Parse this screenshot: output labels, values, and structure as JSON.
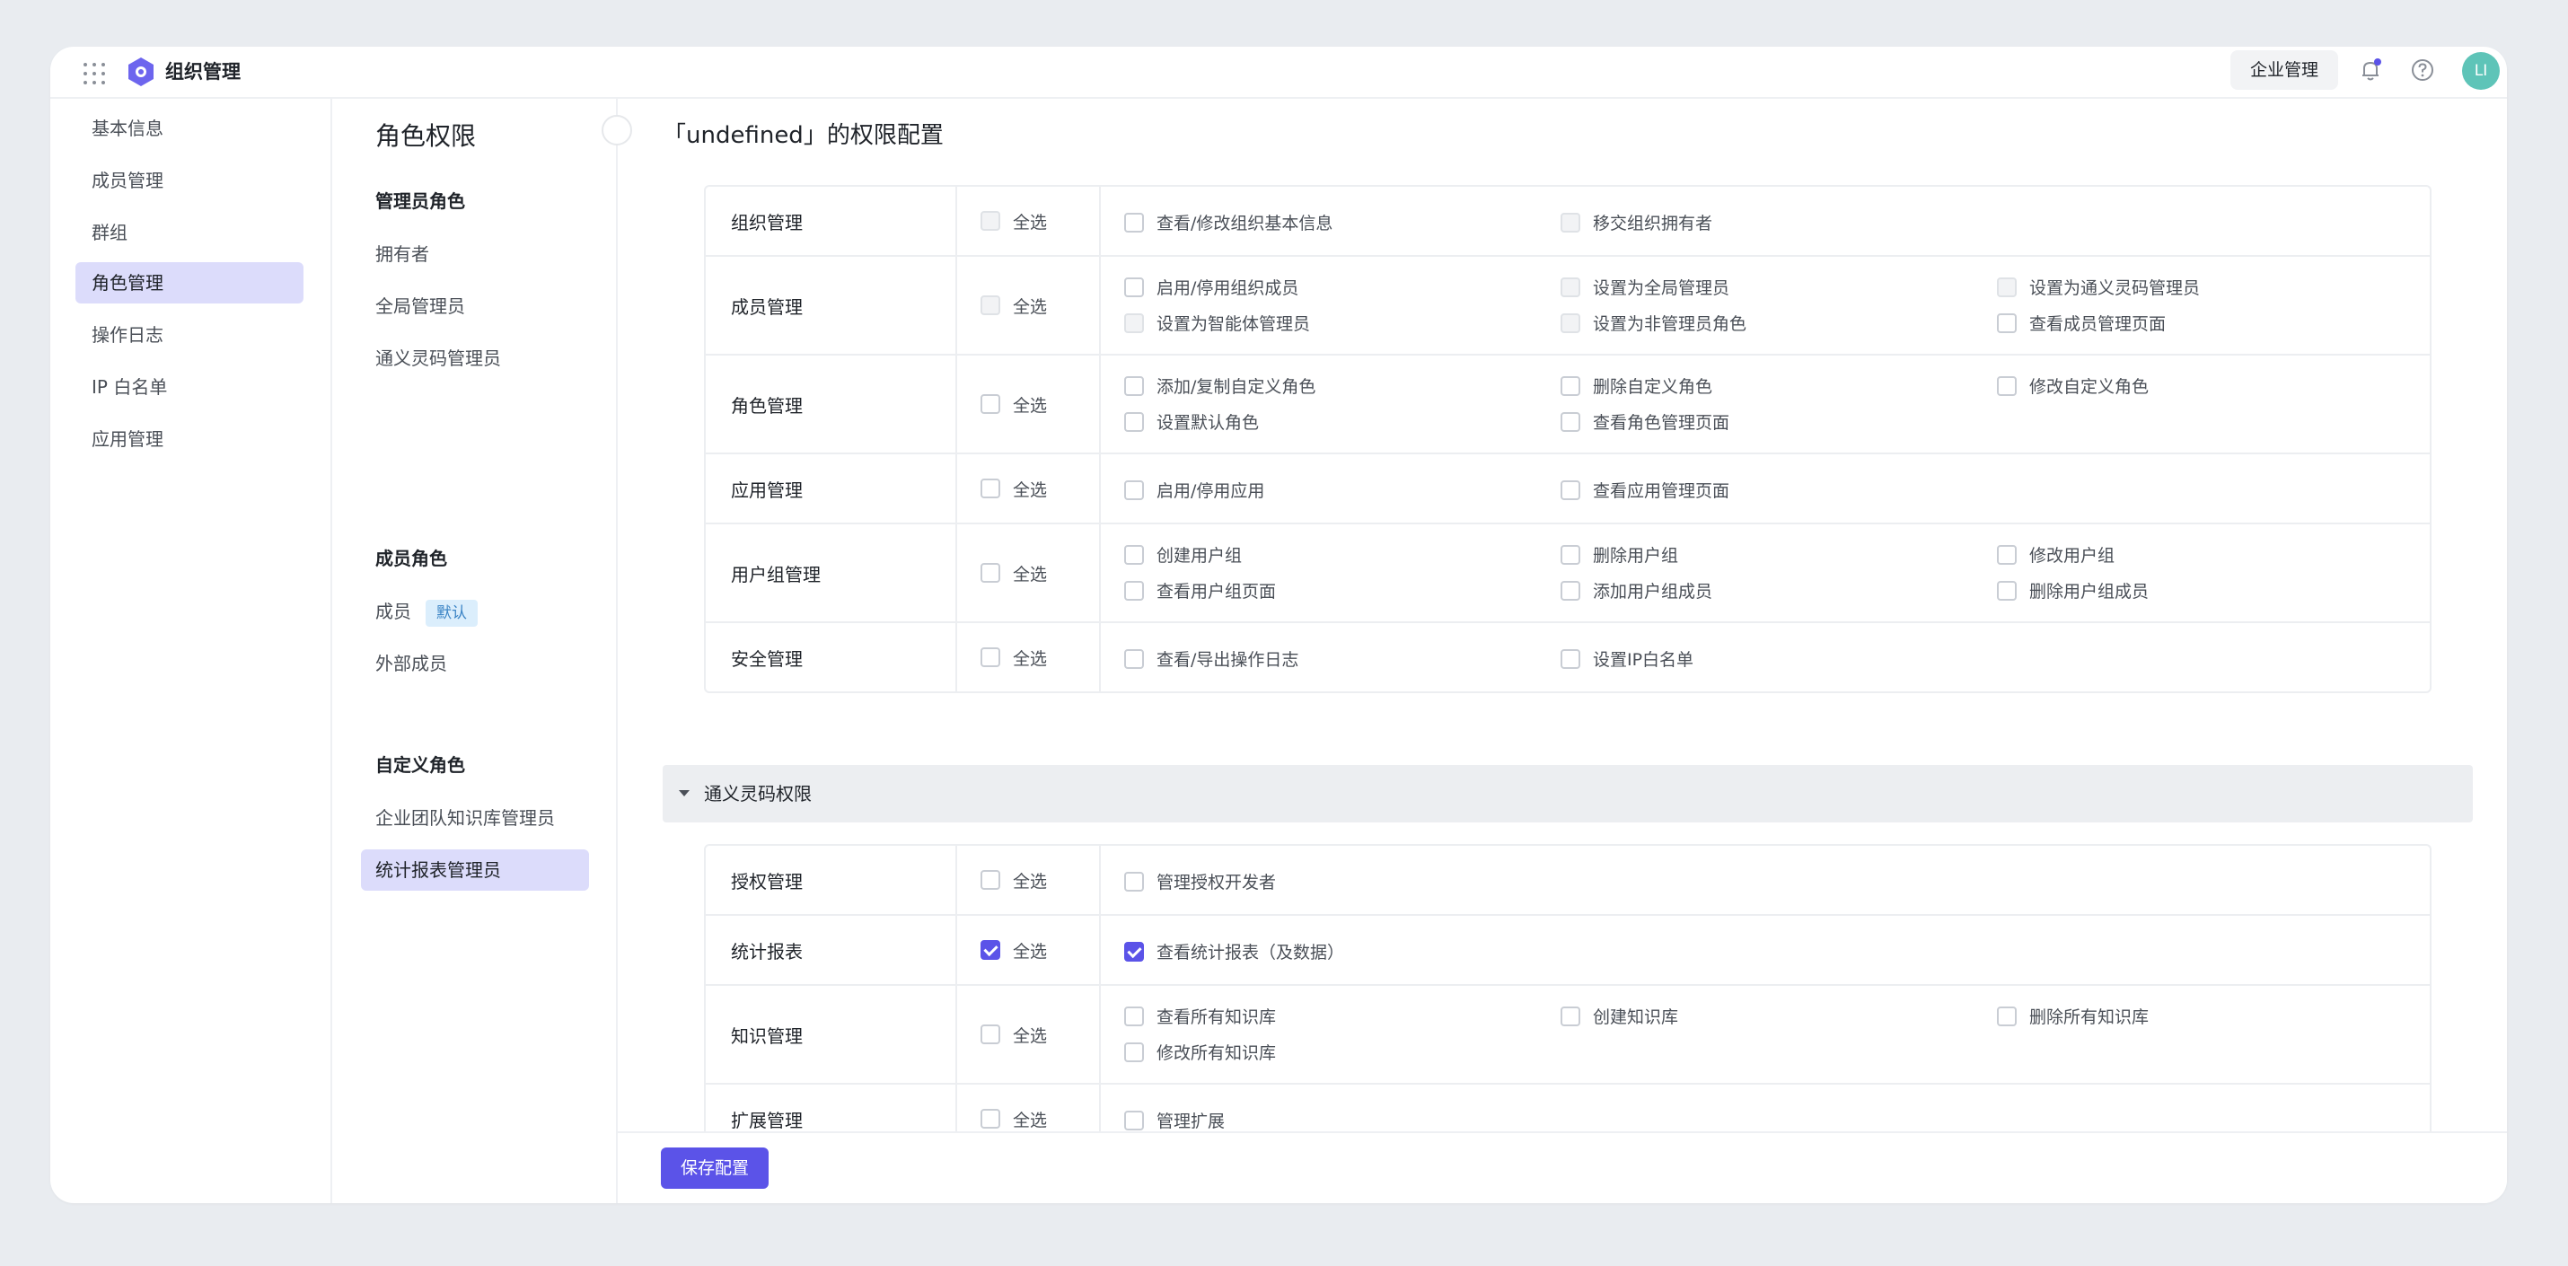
{
  "topbar": {
    "title": "组织管理",
    "enterprise_button": "企业管理",
    "avatar_text": "LI",
    "accent": "#5b53e8"
  },
  "nav": {
    "items": [
      {
        "label": "基本信息"
      },
      {
        "label": "成员管理"
      },
      {
        "label": "群组"
      },
      {
        "label": "角色管理",
        "active": true
      },
      {
        "label": "操作日志"
      },
      {
        "label": "IP 白名单"
      },
      {
        "label": "应用管理"
      }
    ]
  },
  "roles": {
    "title": "角色权限",
    "admin_group": "管理员角色",
    "admin_items": [
      "拥有者",
      "全局管理员",
      "通义灵码管理员"
    ],
    "member_group": "成员角色",
    "member_items": [
      "成员",
      "外部成员"
    ],
    "default_tag": "默认",
    "custom_group": "自定义角色",
    "custom_items": [
      "企业团队知识库管理员",
      "统计报表管理员"
    ]
  },
  "main": {
    "title": "「undefined」的权限配置",
    "select_all": "全选",
    "org_rows": [
      {
        "name": "组织管理",
        "all": "disabled",
        "items": [
          {
            "label": "查看/修改组织基本信息",
            "state": "off"
          },
          {
            "label": "移交组织拥有者",
            "state": "disabled"
          }
        ]
      },
      {
        "name": "成员管理",
        "all": "disabled",
        "items": [
          {
            "label": "启用/停用组织成员",
            "state": "off"
          },
          {
            "label": "设置为全局管理员",
            "state": "disabled"
          },
          {
            "label": "设置为通义灵码管理员",
            "state": "disabled"
          },
          {
            "label": "设置为智能体管理员",
            "state": "disabled"
          },
          {
            "label": "设置为非管理员角色",
            "state": "disabled"
          },
          {
            "label": "查看成员管理页面",
            "state": "off"
          }
        ]
      },
      {
        "name": "角色管理",
        "all": "off",
        "items": [
          {
            "label": "添加/复制自定义角色",
            "state": "off"
          },
          {
            "label": "删除自定义角色",
            "state": "off"
          },
          {
            "label": "修改自定义角色",
            "state": "off"
          },
          {
            "label": "设置默认角色",
            "state": "off"
          },
          {
            "label": "查看角色管理页面",
            "state": "off"
          }
        ]
      },
      {
        "name": "应用管理",
        "all": "off",
        "items": [
          {
            "label": "启用/停用应用",
            "state": "off"
          },
          {
            "label": "查看应用管理页面",
            "state": "off"
          }
        ]
      },
      {
        "name": "用户组管理",
        "all": "off",
        "items": [
          {
            "label": "创建用户组",
            "state": "off"
          },
          {
            "label": "删除用户组",
            "state": "off"
          },
          {
            "label": "修改用户组",
            "state": "off"
          },
          {
            "label": "查看用户组页面",
            "state": "off"
          },
          {
            "label": "添加用户组成员",
            "state": "off"
          },
          {
            "label": "删除用户组成员",
            "state": "off"
          }
        ]
      },
      {
        "name": "安全管理",
        "all": "off",
        "items": [
          {
            "label": "查看/导出操作日志",
            "state": "off"
          },
          {
            "label": "设置IP白名单",
            "state": "off"
          }
        ]
      }
    ],
    "section_title": "通义灵码权限",
    "lingma_rows": [
      {
        "name": "授权管理",
        "all": "off",
        "items": [
          {
            "label": "管理授权开发者",
            "state": "off"
          }
        ]
      },
      {
        "name": "统计报表",
        "all": "on",
        "items": [
          {
            "label": "查看统计报表（及数据）",
            "state": "on"
          }
        ]
      },
      {
        "name": "知识管理",
        "all": "off",
        "items": [
          {
            "label": "查看所有知识库",
            "state": "off"
          },
          {
            "label": "创建知识库",
            "state": "off"
          },
          {
            "label": "删除所有知识库",
            "state": "off"
          },
          {
            "label": "修改所有知识库",
            "state": "off"
          }
        ]
      },
      {
        "name": "扩展管理",
        "all": "off",
        "items": [
          {
            "label": "管理扩展",
            "state": "off"
          }
        ]
      }
    ],
    "save_button": "保存配置"
  }
}
